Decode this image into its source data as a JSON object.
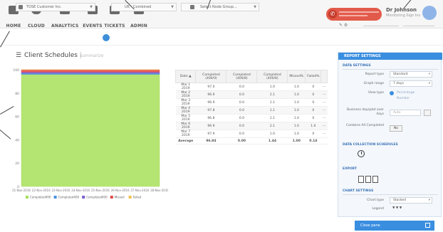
{
  "nav": {
    "items": [
      {
        "label": "HOME",
        "icon": "home-icon"
      },
      {
        "label": "CLOUD",
        "icon": "cloud-icon"
      },
      {
        "label": "ANALYTICS",
        "icon": "analytics-icon"
      },
      {
        "label": "EVENTS",
        "icon": "events-icon"
      },
      {
        "label": "TICKETS",
        "icon": "tickets-icon"
      },
      {
        "label": "ADMIN",
        "icon": "admin-icon"
      }
    ]
  },
  "user": {
    "name": "Dr Johnson",
    "subtitle": "Monitoring Sign Ins"
  },
  "filters": {
    "company": "TOSE Customer Inc.",
    "timezone": "UK - Combined",
    "node_group": "Select Node Group..."
  },
  "page": {
    "title": "Client Schedules",
    "subtitle": "summarize"
  },
  "chart_data": {
    "type": "area",
    "title": "",
    "x": [
      "21-Nov-2016",
      "22-Nov-2016",
      "23-Nov-2016",
      "24-Nov-2016",
      "25-Nov-2016",
      "26-Nov-2016",
      "27-Nov-2016",
      "28-Nov-2016"
    ],
    "ylim": [
      0,
      100
    ],
    "yticks": [
      "100",
      "80",
      "60",
      "40",
      "20",
      "0"
    ],
    "series": [
      {
        "name": "Completed400",
        "color": "#a7e05a",
        "values": [
          96,
          96,
          96,
          96,
          96,
          96,
          96,
          96
        ]
      },
      {
        "name": "Completed400",
        "color": "#4a90e2",
        "values": [
          1,
          1,
          1,
          1,
          1,
          1,
          1,
          1
        ]
      },
      {
        "name": "Completed400",
        "color": "#7b5fd0",
        "values": [
          1,
          1,
          1,
          1,
          1,
          1,
          1,
          1
        ]
      },
      {
        "name": "Missed",
        "color": "#e24a4a",
        "values": [
          2,
          2,
          2,
          2,
          2,
          2,
          2,
          2
        ]
      },
      {
        "name": "Failed",
        "color": "#f2c24f",
        "values": [
          0,
          0,
          0,
          0,
          0,
          0,
          0,
          0
        ]
      }
    ],
    "legend": "bottom"
  },
  "table": {
    "headers": [
      "Date ▲",
      "Completed (400/0)",
      "Completed (400/8)",
      "Completed (400/8)",
      "Missed%",
      "Failed%",
      ""
    ],
    "rows": [
      [
        "Mar 1 2019",
        "97.0",
        "0.0",
        "1.0",
        "1.0",
        "0",
        "⋯"
      ],
      [
        "Mar 2 2019",
        "96.9",
        "0.0",
        "2.1",
        "1.0",
        "0",
        "⋯"
      ],
      [
        "Mar 3 2019",
        "96.9",
        "0.0",
        "1.1",
        "1.0",
        "0",
        "⋯"
      ],
      [
        "Mar 4 2019",
        "97.8",
        "0.0",
        "1.1",
        "1.0",
        "0",
        "⋯"
      ],
      [
        "Mar 5 2019",
        "96.8",
        "0.0",
        "1.1",
        "1.0",
        "0",
        "⋯"
      ],
      [
        "Mar 6 2019",
        "96.9",
        "0.0",
        "2.1",
        "1.0",
        "1.0",
        "⋯"
      ],
      [
        "Mar 7 2019",
        "97.9",
        "0.0",
        "1.0",
        "1.0",
        "0",
        "⋯"
      ]
    ],
    "average": [
      "Average",
      "96.84",
      "0.00",
      "1.44",
      "1.00",
      "0.14",
      ""
    ]
  },
  "panel": {
    "header": "REPORT SETTINGS",
    "data_settings": {
      "title": "DATA SETTINGS",
      "report_type_label": "Report type",
      "report_type_value": "Standard",
      "graph_range_label": "Graph range",
      "graph_range_value": "7 days",
      "view_type_label": "View type",
      "view_type_opt1": "Percentage",
      "view_type_opt2": "Number",
      "business_label": "Business daysplot over days",
      "business_value": "Auto",
      "combine_label": "Combine All Completed",
      "combine_value": "No"
    },
    "data_collection": {
      "title": "DATA COLLECTION SCHEDULES"
    },
    "export": {
      "title": "EXPORT"
    },
    "chart_settings": {
      "title": "CHART SETTINGS",
      "chart_type_label": "Chart type",
      "chart_type_value": "Stacked",
      "legend_label": "Legend",
      "legend_value": "▼ ▼ ▼"
    },
    "close_label": "Close pane"
  }
}
